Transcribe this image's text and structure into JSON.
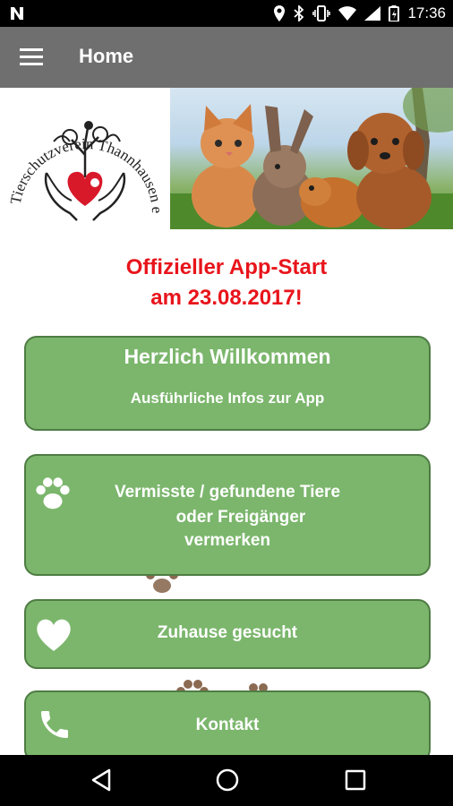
{
  "status_bar": {
    "time": "17:36"
  },
  "app_bar": {
    "title": "Home"
  },
  "banner": {
    "logo_arc_text": "Tierschutzverein Thannhausen e.V."
  },
  "announcement": {
    "line1": "Offizieller App-Start",
    "line2": "am 23.08.2017!"
  },
  "buttons": {
    "welcome": {
      "title": "Herzlich Willkommen",
      "subtitle": "Ausführliche Infos zur App"
    },
    "missing": {
      "line1": "Vermisste / gefundene Tiere",
      "line2": "oder Freigänger",
      "line3": "vermerken"
    },
    "home_wanted": {
      "label": "Zuhause gesucht"
    },
    "contact": {
      "label": "Kontakt"
    }
  },
  "colors": {
    "status_bar": "#000000",
    "app_bar": "#6f6f6f",
    "announcement": "#e8141b",
    "button_fill": "#7bb66c",
    "button_border": "#4e7c43",
    "paw_watermark": "#8b6a52"
  },
  "icons": [
    "notification-n-icon",
    "location-icon",
    "bluetooth-icon",
    "vibrate-icon",
    "wifi-icon",
    "signal-icon",
    "battery-icon",
    "menu-icon",
    "paw-icon",
    "heart-icon",
    "phone-icon",
    "back-icon",
    "home-icon",
    "recents-icon"
  ]
}
